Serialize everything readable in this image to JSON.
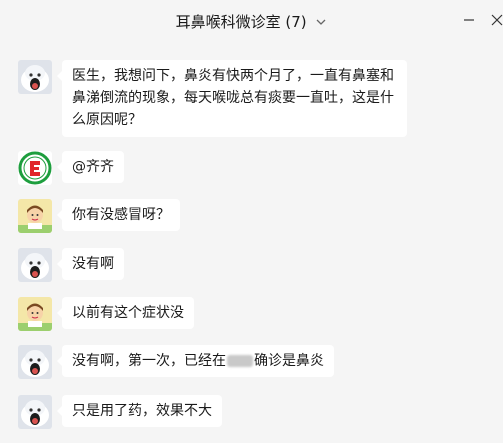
{
  "header": {
    "title": "耳鼻喉科微诊室",
    "member_count": "(7)",
    "dropdown_icon": "chevron-down-icon",
    "minimize_icon": "minimize-icon",
    "close_icon": "close-icon"
  },
  "messages": [
    {
      "sender_avatar": "white-cat-avatar",
      "text": "医生，我想问下，鼻炎有快两个月了，一直有鼻塞和鼻涕倒流的现象，每天喉咙总有痰要一直吐，这是什么原因呢？"
    },
    {
      "sender_avatar": "hospital-logo-avatar",
      "text": "@齐齐"
    },
    {
      "sender_avatar": "cartoon-doctor-avatar",
      "text": "你有没感冒呀？"
    },
    {
      "sender_avatar": "white-cat-avatar",
      "text": "没有啊"
    },
    {
      "sender_avatar": "cartoon-doctor-avatar",
      "text": "以前有这个症状没"
    },
    {
      "sender_avatar": "white-cat-avatar",
      "text_before": "没有啊，第一次，已经在",
      "text_after": "确诊是鼻炎"
    },
    {
      "sender_avatar": "white-cat-avatar",
      "text": "只是用了药，效果不大"
    }
  ],
  "colors": {
    "background": "#f5f5f5",
    "bubble": "#ffffff",
    "text": "#1a1a1a",
    "logo_green": "#1e9e3e",
    "logo_red": "#e0262a"
  }
}
